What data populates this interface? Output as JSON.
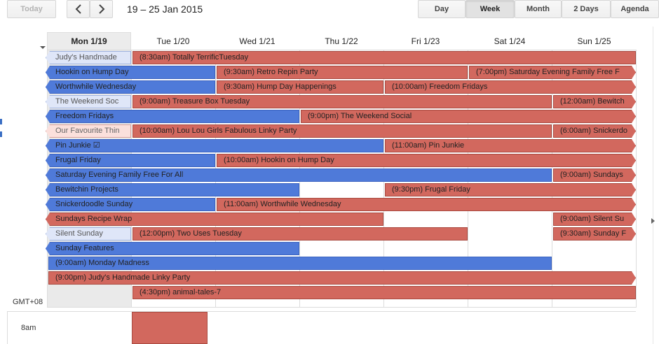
{
  "toolbar": {
    "today": "Today",
    "prev_icon": "chevron-left-icon",
    "next_icon": "chevron-right-icon",
    "date_range": "19 – 25 Jan 2015",
    "views": [
      "Day",
      "Week",
      "Month",
      "2 Days",
      "Agenda"
    ],
    "active_view": "Week"
  },
  "days": [
    "Mon 1/19",
    "Tue 1/20",
    "Wed 1/21",
    "Thu 1/22",
    "Fri 1/23",
    "Sat 1/24",
    "Sun 1/25"
  ],
  "today_index": 0,
  "colors": {
    "red": "#d2685e",
    "blue": "#4f7ad9",
    "light_blue": "#dfe6f8",
    "light_red": "#fbe0dc"
  },
  "events": [
    {
      "text": "Judy's Handmade",
      "row": 0,
      "start": 0,
      "span": 1,
      "style": "light-blue",
      "arrow": "left"
    },
    {
      "text": "(8:30am) Totally TerrificTuesday",
      "row": 0,
      "start": 1,
      "span": 6,
      "style": "red",
      "arrow": "none"
    },
    {
      "text": "Hookin on Hump Day",
      "row": 1,
      "start": 0,
      "span": 2,
      "style": "blue",
      "arrow": "left"
    },
    {
      "text": "(9:30am) Retro Repin Party",
      "row": 1,
      "start": 2,
      "span": 3,
      "style": "red",
      "arrow": "none"
    },
    {
      "text": "(7:00pm) Saturday Evening Family Free F",
      "row": 1,
      "start": 5,
      "span": 2,
      "style": "red",
      "arrow": "right"
    },
    {
      "text": "Worthwhile Wednesday",
      "row": 2,
      "start": 0,
      "span": 2,
      "style": "blue",
      "arrow": "left"
    },
    {
      "text": "(9:30am) Hump Day Happenings",
      "row": 2,
      "start": 2,
      "span": 2,
      "style": "red",
      "arrow": "none"
    },
    {
      "text": "(10:00am) Freedom Fridays",
      "row": 2,
      "start": 4,
      "span": 3,
      "style": "red",
      "arrow": "right"
    },
    {
      "text": "The Weekend Soc",
      "row": 3,
      "start": 0,
      "span": 1,
      "style": "light-blue",
      "arrow": "left"
    },
    {
      "text": "(9:00am) Treasure Box Tuesday",
      "row": 3,
      "start": 1,
      "span": 5,
      "style": "red",
      "arrow": "none"
    },
    {
      "text": "(12:00am) Bewitch",
      "row": 3,
      "start": 6,
      "span": 1,
      "style": "red",
      "arrow": "right"
    },
    {
      "text": "Freedom Fridays",
      "row": 4,
      "start": 0,
      "span": 3,
      "style": "blue",
      "arrow": "left"
    },
    {
      "text": "(9:00pm) The Weekend Social",
      "row": 4,
      "start": 3,
      "span": 4,
      "style": "red",
      "arrow": "right"
    },
    {
      "text": "Our Favourite Thin",
      "row": 5,
      "start": 0,
      "span": 1,
      "style": "light-red",
      "arrow": "left"
    },
    {
      "text": "(10:00am) Lou Lou Girls Fabulous Linky Party",
      "row": 5,
      "start": 1,
      "span": 5,
      "style": "red",
      "arrow": "none"
    },
    {
      "text": "(6:00am) Snickerdo",
      "row": 5,
      "start": 6,
      "span": 1,
      "style": "red",
      "arrow": "right"
    },
    {
      "text": "Pin Junkie ☑",
      "row": 6,
      "start": 0,
      "span": 4,
      "style": "blue",
      "arrow": "left"
    },
    {
      "text": "(11:00am) Pin Junkie",
      "row": 6,
      "start": 4,
      "span": 3,
      "style": "red",
      "arrow": "right"
    },
    {
      "text": "Frugal Friday",
      "row": 7,
      "start": 0,
      "span": 2,
      "style": "blue",
      "arrow": "left"
    },
    {
      "text": "(10:00am) Hookin on Hump Day",
      "row": 7,
      "start": 2,
      "span": 5,
      "style": "red",
      "arrow": "right"
    },
    {
      "text": "Saturday Evening Family Free For All",
      "row": 8,
      "start": 0,
      "span": 6,
      "style": "blue",
      "arrow": "left"
    },
    {
      "text": "(9:00am) Sundays",
      "row": 8,
      "start": 6,
      "span": 1,
      "style": "red",
      "arrow": "right"
    },
    {
      "text": "Bewitchin Projects",
      "row": 9,
      "start": 0,
      "span": 3,
      "style": "blue",
      "arrow": "left"
    },
    {
      "text": "(9:30pm) Frugal Friday",
      "row": 9,
      "start": 4,
      "span": 3,
      "style": "red",
      "arrow": "right"
    },
    {
      "text": "Snickerdoodle Sunday",
      "row": 10,
      "start": 0,
      "span": 2,
      "style": "blue",
      "arrow": "left"
    },
    {
      "text": "(11:00am) Worthwhile Wednesday",
      "row": 10,
      "start": 2,
      "span": 5,
      "style": "red",
      "arrow": "right"
    },
    {
      "text": "Sundays Recipe Wrap",
      "row": 11,
      "start": 0,
      "span": 4,
      "style": "red",
      "arrow": "left"
    },
    {
      "text": "(9:00am) Silent Su",
      "row": 11,
      "start": 6,
      "span": 1,
      "style": "red",
      "arrow": "right"
    },
    {
      "text": "Silent Sunday",
      "row": 12,
      "start": 0,
      "span": 1,
      "style": "light-blue",
      "arrow": "left"
    },
    {
      "text": "(12:00pm) Two Uses Tuesday",
      "row": 12,
      "start": 1,
      "span": 4,
      "style": "red",
      "arrow": "none"
    },
    {
      "text": "(9:30am) Sunday F",
      "row": 12,
      "start": 6,
      "span": 1,
      "style": "red",
      "arrow": "right"
    },
    {
      "text": "Sunday Features",
      "row": 13,
      "start": 0,
      "span": 3,
      "style": "blue",
      "arrow": "left"
    },
    {
      "text": "(9:00am) Monday Madness",
      "row": 14,
      "start": 0,
      "span": 6,
      "style": "blue",
      "arrow": "none"
    },
    {
      "text": "(9:00pm) Judy's Handmade Linky Party",
      "row": 15,
      "start": 0,
      "span": 7,
      "style": "red",
      "arrow": "right"
    },
    {
      "text": "(4:30pm) animal-tales-7",
      "row": 16,
      "start": 1,
      "span": 6,
      "style": "red",
      "arrow": "none"
    }
  ],
  "timezone": "GMT+08",
  "time_label": "8am"
}
